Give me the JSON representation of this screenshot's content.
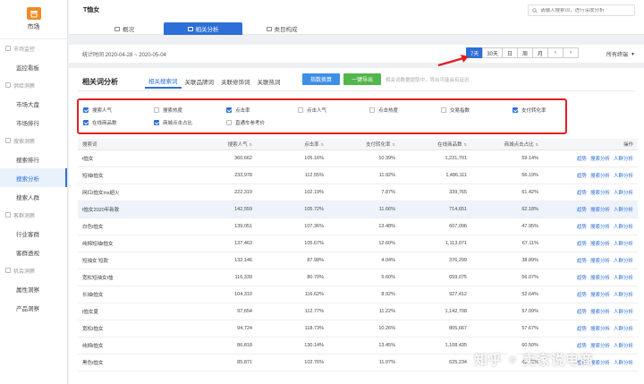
{
  "app": {
    "logo_label": "市场"
  },
  "sidebar": {
    "sections": [
      {
        "label": "市场监控",
        "items": [
          "监控看板"
        ]
      },
      {
        "label": "供给洞察",
        "items": [
          "市场大盘",
          "市场排行"
        ]
      },
      {
        "label": "搜索洞察",
        "items": [
          "搜索排行",
          "搜索分析",
          "搜索人群"
        ]
      },
      {
        "label": "客群洞察",
        "items": [
          "行业客群",
          "客群透视"
        ]
      },
      {
        "label": "机会洞察",
        "items": [
          "属性洞察",
          "产品洞察"
        ]
      }
    ],
    "active_item": "搜索分析"
  },
  "header": {
    "title": "T恤女",
    "tabs": [
      "概况",
      "相关分析",
      "类目构成"
    ],
    "active_tab": "相关分析",
    "search_placeholder": "请输入搜索词，进行深度分析"
  },
  "date_bar": {
    "range_text": "统计时间 2020-04-28 ~ 2020-05-04",
    "periods": [
      "7天",
      "30天",
      "日",
      "周",
      "月"
    ],
    "active_period": "7天",
    "prev": "‹",
    "next": "›",
    "terminal_label": "所有终端"
  },
  "panel": {
    "title": "相关词分析",
    "tabs": [
      "相关搜索词",
      "关联品牌词",
      "关联修饰词",
      "关联热词"
    ],
    "active_tab": "相关搜索词",
    "index_button": "指数换算",
    "export_button": "一键导出",
    "hint": "相关词数据提取中，导出可能会有延迟"
  },
  "metrics": [
    {
      "label": "搜索人气",
      "checked": true
    },
    {
      "label": "搜索热度",
      "checked": false
    },
    {
      "label": "点击率",
      "checked": true
    },
    {
      "label": "点击人气",
      "checked": false
    },
    {
      "label": "点击热度",
      "checked": false
    },
    {
      "label": "交易指数",
      "checked": false
    },
    {
      "label": "支付转化率",
      "checked": true
    },
    {
      "label": "在线商品数",
      "checked": true
    },
    {
      "label": "商城点击占比",
      "checked": true
    },
    {
      "label": "直通车参考价",
      "checked": false
    }
  ],
  "table": {
    "headers": [
      "搜索词",
      "搜索人气",
      "点击率",
      "支付转化率",
      "在线商品数",
      "商城点击占比",
      "操作"
    ],
    "actions": [
      "趋势",
      "搜索分析",
      "人群分析"
    ],
    "highlight_row": 3,
    "rows": [
      [
        "t恤女",
        "360,662",
        "105.16%",
        "10.39%",
        "1,231,701",
        "59.14%"
      ],
      [
        "短袖t恤女",
        "233,978",
        "112.55%",
        "11.92%",
        "1,486,111",
        "56.19%"
      ],
      [
        "网红t恤女ins超火",
        "222,319",
        "102.19%",
        "7.87%",
        "339,765",
        "61.42%"
      ],
      [
        "t恤女2020年新款",
        "142,559",
        "105.72%",
        "11.66%",
        "714,651",
        "62.18%"
      ],
      [
        "白色t恤女",
        "139,051",
        "107.36%",
        "13.48%",
        "607,096",
        "47.95%"
      ],
      [
        "纯棉短袖t恤女",
        "137,463",
        "105.67%",
        "12.60%",
        "1,113,071",
        "67.11%"
      ],
      [
        "短袖女 短款",
        "132,146",
        "87.98%",
        "4.04%",
        "376,299",
        "38.89%"
      ],
      [
        "宽松短袖女t恤",
        "116,339",
        "80.70%",
        "5.60%",
        "659,075",
        "56.07%"
      ],
      [
        "长袖t恤女",
        "104,310",
        "116.62%",
        "8.92%",
        "927,412",
        "52.64%"
      ],
      [
        "t恤女夏",
        "97,654",
        "112.77%",
        "11.22%",
        "1,142,708",
        "57.09%"
      ],
      [
        "宽松t恤女",
        "94,724",
        "118.73%",
        "10.26%",
        "805,667",
        "57.67%"
      ],
      [
        "纯棉t恤女",
        "86,818",
        "130.14%",
        "13.45%",
        "1,108,435",
        "60.50%"
      ],
      [
        "黑色t恤女",
        "85,871",
        "102.76%",
        "11.07%",
        "625,234",
        "48.09%"
      ]
    ]
  },
  "watermark": {
    "prefix": "知乎",
    "at": "@",
    "name": "卖家说电商"
  },
  "colors": {
    "accent": "#2d6fd6",
    "annotation": "#e02020",
    "export_green": "#52b74a",
    "logo_orange": "#f08a24"
  }
}
